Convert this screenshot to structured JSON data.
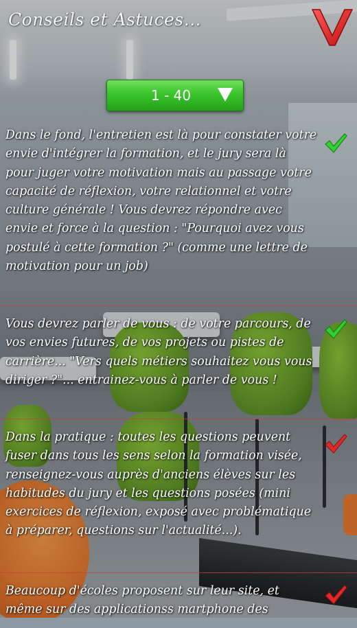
{
  "header": {
    "title": "Conseils et Astuces...",
    "close_icon": "red-chevron-v-icon",
    "accent_color": "#e02020"
  },
  "selector": {
    "label": "1 - 40",
    "icon": "triangle-down-icon",
    "color": "#3ac42c"
  },
  "tips": [
    {
      "text": "Dans le fond, l'entretien est là pour constater votre envie d'intégrer la formation, et le jury sera là pour juger votre motivation mais au passage votre capacité de réflexion, votre relationnel et votre culture générale ! Vous devrez répondre avec envie et force à la question : \"Pourquoi avez vous postulé à cette formation ?\" (comme une lettre de motivation pour un job)",
      "status": "read",
      "check_color": "#2fd12f"
    },
    {
      "text": "Vous devrez parler de vous : de votre parcours, de vos envies futures, de vos projets ou pistes de carrière... \"Vers quels métiers souhaitez vous vous diriger ?\"... entrainez-vous à parler de vous !",
      "status": "read",
      "check_color": "#2fd12f"
    },
    {
      "text": "Dans la pratique : toutes les questions peuvent fuser dans tous les sens selon la formation visée, renseignez-vous auprès d'anciens élèves sur les habitudes du jury et les questions posées (mini exercices de réflexion, exposé avec problématique à préparer, questions sur l'actualité...).",
      "status": "unread",
      "check_color": "#e02a2a"
    },
    {
      "text": "Beaucoup d'écoles proposent sur leur site, et même sur des applicationss martphone des",
      "status": "unread",
      "check_color": "#e02a2a"
    }
  ]
}
